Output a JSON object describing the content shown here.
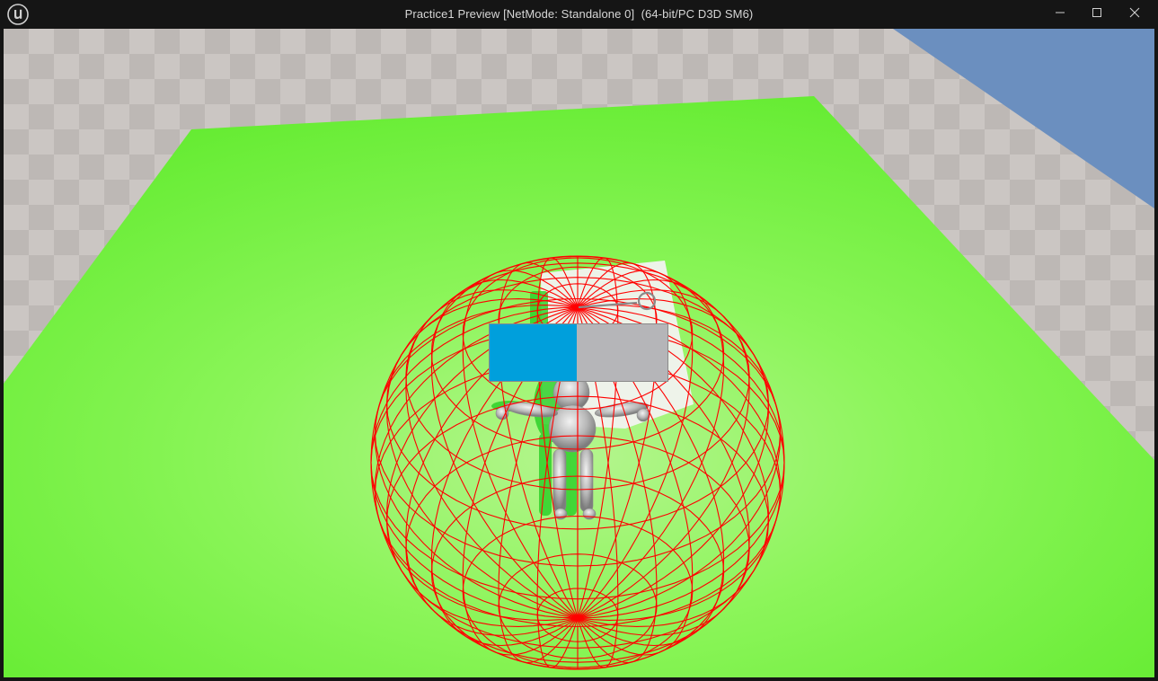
{
  "window": {
    "title": "Practice1 Preview [NetMode: Standalone 0]  (64-bit/PC D3D SM6)",
    "logo_icon": "unreal-engine-logo-icon",
    "controls": {
      "minimize_icon": "minimize-icon",
      "maximize_icon": "maximize-icon",
      "close_icon": "close-icon"
    }
  },
  "viewport": {
    "sky_color": "#6b8fbf",
    "floor_color": "#c9c4c1",
    "platform_color": "#7cf24c",
    "debug_sphere_color": "#ff0000",
    "character_color": "#cfcfcf"
  },
  "hud": {
    "health_bar": {
      "fill_fraction": 0.49,
      "fill_color": "#009fdc",
      "background_color": "#b5b5b8"
    }
  }
}
